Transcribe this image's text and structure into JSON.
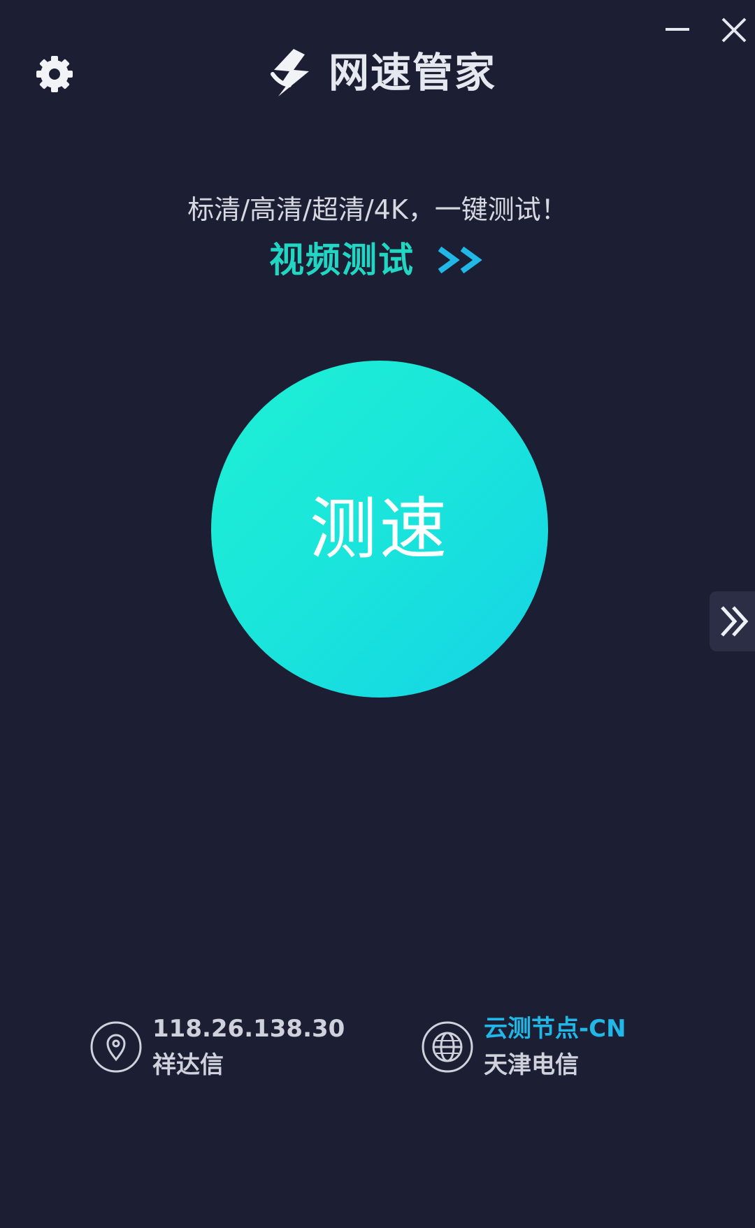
{
  "window": {
    "minimize_icon": "minimize-icon",
    "close_icon": "close-icon"
  },
  "header": {
    "title": "网速管家",
    "logo_icon": "lightning-logo-icon",
    "settings_icon": "gear-icon"
  },
  "promo": {
    "subtitle": "标清/高清/超清/4K，一键测试！",
    "link_label": "视频测试",
    "link_icon": "double-chevron-right-icon"
  },
  "speed_test": {
    "button_label": "测速"
  },
  "side_tab": {
    "icon": "double-chevron-right-icon"
  },
  "client": {
    "ip": "118.26.138.30",
    "isp": "祥达信",
    "icon": "location-pin-icon"
  },
  "server": {
    "node": "云测节点-CN",
    "location": "天津电信",
    "icon": "globe-icon"
  },
  "colors": {
    "background": "#1c1f33",
    "accent_teal": "#21d7c4",
    "accent_blue": "#21b8e8",
    "button_gradient_start": "#1ff0d4",
    "button_gradient_end": "#15d3e6"
  }
}
